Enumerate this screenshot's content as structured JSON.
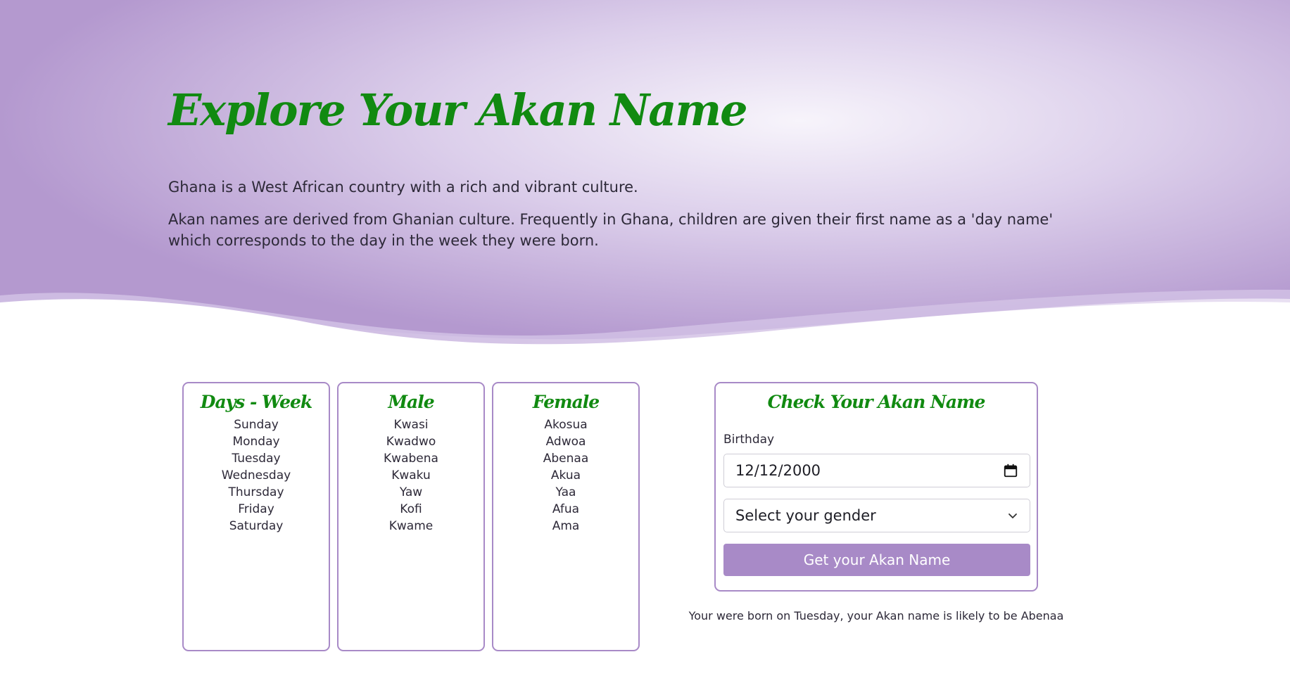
{
  "hero": {
    "title": "Explore Your Akan Name",
    "intro": "Ghana is a West African country with a rich and vibrant culture.",
    "description": "Akan names are derived from Ghanian culture. Frequently in Ghana, children are given their first name as a 'day name' which corresponds to the day in the week they were born."
  },
  "tables": {
    "days": {
      "title": "Days - Week",
      "items": [
        "Sunday",
        "Monday",
        "Tuesday",
        "Wednesday",
        "Thursday",
        "Friday",
        "Saturday"
      ]
    },
    "male": {
      "title": "Male",
      "items": [
        "Kwasi",
        "Kwadwo",
        "Kwabena",
        "Kwaku",
        "Yaw",
        "Kofi",
        "Kwame"
      ]
    },
    "female": {
      "title": "Female",
      "items": [
        "Akosua",
        "Adwoa",
        "Abenaa",
        "Akua",
        "Yaa",
        "Afua",
        "Ama"
      ]
    }
  },
  "form": {
    "title": "Check Your Akan Name",
    "birthday_label": "Birthday",
    "birthday_value": "12/12/2000",
    "gender_select": "Select your gender",
    "submit_label": "Get your Akan Name",
    "calendar_icon": "calendar-icon",
    "chevron_icon": "chevron-down-icon"
  },
  "result": "Your were born on Tuesday, your Akan name is likely to be Abenaa",
  "colors": {
    "accent": "#a88ac7",
    "title_green": "#118a11",
    "hero_bg": "#c6b1dc"
  }
}
